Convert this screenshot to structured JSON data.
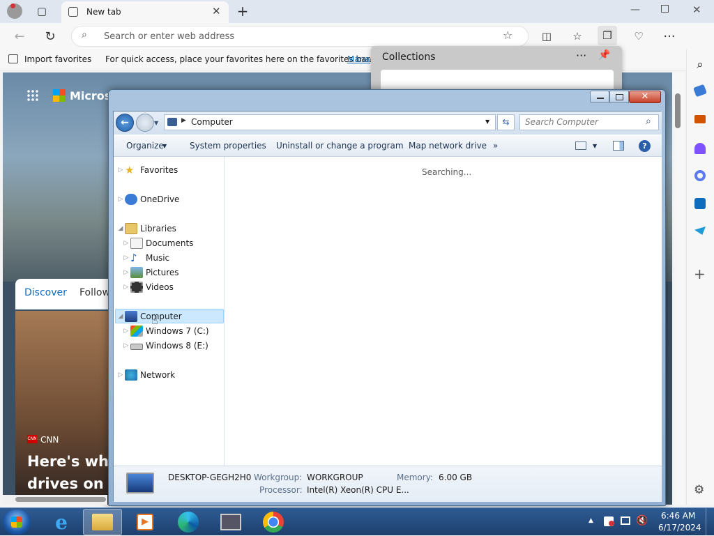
{
  "browser": {
    "tab_title": "New tab",
    "address_placeholder": "Search or enter web address",
    "import_favorites": "Import favorites",
    "favbar_hint": "For quick access, place your favorites here on the favorites bar.",
    "favbar_link": "Manag",
    "collections_title": "Collections"
  },
  "newtab": {
    "brand": "Microso",
    "discover": "Discover",
    "following": "Follow",
    "news_source": "CNN",
    "headline_1": "Here's why",
    "headline_2": "drives on t"
  },
  "explorer": {
    "breadcrumb": "Computer",
    "search_placeholder": "Search Computer",
    "commands": [
      "Organize",
      "System properties",
      "Uninstall or change a program",
      "Map network drive"
    ],
    "more": "»",
    "status": "Searching...",
    "tree": {
      "favorites": "Favorites",
      "onedrive": "OneDrive",
      "libraries": "Libraries",
      "documents": "Documents",
      "music": "Music",
      "pictures": "Pictures",
      "videos": "Videos",
      "computer": "Computer",
      "win7": "Windows 7 (C:)",
      "win8": "Windows 8 (E:)",
      "network": "Network"
    },
    "details": {
      "name": "DESKTOP-GEGH2H0",
      "workgroup_label": "Workgroup:",
      "workgroup": "WORKGROUP",
      "memory_label": "Memory:",
      "memory": "6.00 GB",
      "processor_label": "Processor:",
      "processor": "Intel(R) Xeon(R) CPU E..."
    }
  },
  "taskbar": {
    "time": "6:46 AM",
    "date": "6/17/2024"
  },
  "colors": {
    "accent": "#0f6cbd",
    "selection": "#cce8ff",
    "taskbar": "#1d3f6d"
  }
}
